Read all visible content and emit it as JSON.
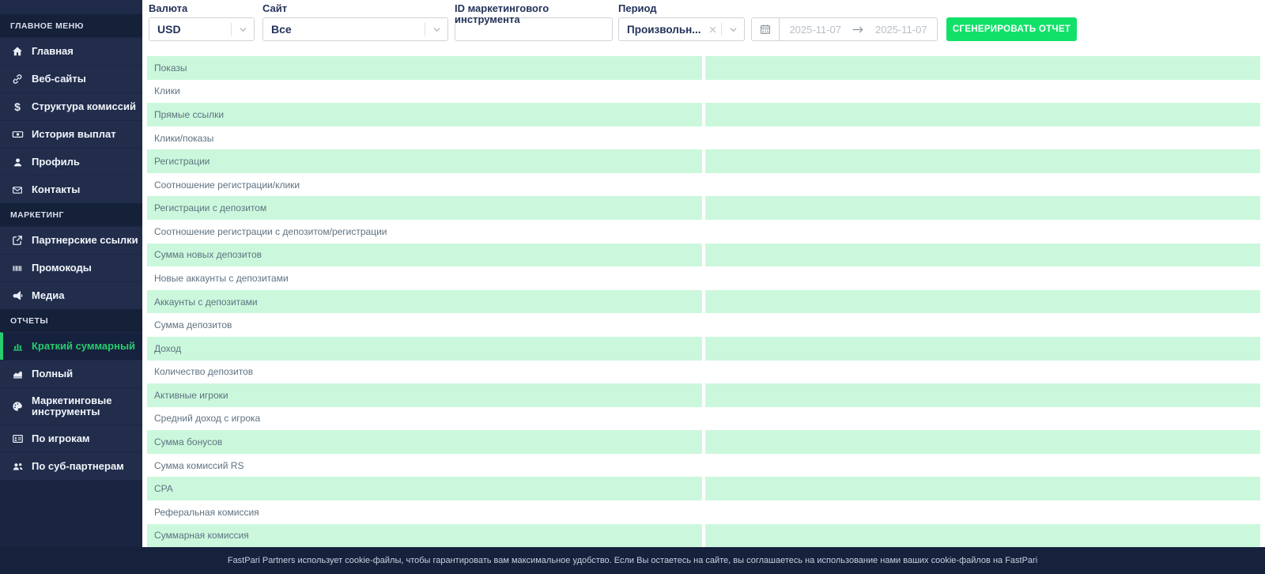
{
  "sidebar": {
    "sections": [
      {
        "header": "ГЛАВНОЕ МЕНЮ",
        "items": [
          {
            "label": "Главная",
            "icon": "home-icon"
          },
          {
            "label": "Веб-сайты",
            "icon": "link-icon"
          },
          {
            "label": "Структура комиссий",
            "icon": "dollar-icon"
          },
          {
            "label": "История выплат",
            "icon": "banknote-icon"
          },
          {
            "label": "Профиль",
            "icon": "user-icon"
          },
          {
            "label": "Контакты",
            "icon": "envelope-icon"
          }
        ]
      },
      {
        "header": "МАРКЕТИНГ",
        "items": [
          {
            "label": "Партнерские ссылки",
            "icon": "external-link-icon"
          },
          {
            "label": "Промокоды",
            "icon": "barcode-icon"
          },
          {
            "label": "Медиа",
            "icon": "megaphone-icon"
          }
        ]
      },
      {
        "header": "ОТЧЕТЫ",
        "items": [
          {
            "label": "Краткий суммарный",
            "icon": "bar-chart-icon",
            "active": true
          },
          {
            "label": "Полный",
            "icon": "area-chart-icon"
          },
          {
            "label": "Маркетинговые инструменты",
            "icon": "palette-icon",
            "tall": true
          },
          {
            "label": "По игрокам",
            "icon": "id-card-icon"
          },
          {
            "label": "По суб-партнерам",
            "icon": "users-icon"
          }
        ]
      }
    ]
  },
  "filters": {
    "currency": {
      "label": "Валюта",
      "value": "USD"
    },
    "site": {
      "label": "Сайт",
      "value": "Все"
    },
    "marketing_id": {
      "label": "ID маркетингового инструмента",
      "value": ""
    },
    "period": {
      "label": "Период",
      "value": "Произвольн..."
    },
    "date_from": "2025-11-07",
    "date_to": "2025-11-07",
    "generate_button": "СГЕНЕРИРОВАТЬ ОТЧЕТ"
  },
  "report": {
    "rows": [
      {
        "label": "Показы",
        "value": ""
      },
      {
        "label": "Клики",
        "value": ""
      },
      {
        "label": "Прямые ссылки",
        "value": ""
      },
      {
        "label": "Клики/показы",
        "value": ""
      },
      {
        "label": "Регистрации",
        "value": ""
      },
      {
        "label": "Соотношение регистрации/клики",
        "value": ""
      },
      {
        "label": "Регистрации с депозитом",
        "value": ""
      },
      {
        "label": "Соотношение регистрации с депозитом/регистрации",
        "value": ""
      },
      {
        "label": "Сумма новых депозитов",
        "value": ""
      },
      {
        "label": "Новые аккаунты с депозитами",
        "value": ""
      },
      {
        "label": "Аккаунты с депозитами",
        "value": ""
      },
      {
        "label": "Сумма депозитов",
        "value": ""
      },
      {
        "label": "Доход",
        "value": ""
      },
      {
        "label": "Количество депозитов",
        "value": ""
      },
      {
        "label": "Активные игроки",
        "value": ""
      },
      {
        "label": "Средний доход с игрока",
        "value": ""
      },
      {
        "label": "Сумма бонусов",
        "value": ""
      },
      {
        "label": "Сумма комиссий RS",
        "value": ""
      },
      {
        "label": "CPA",
        "value": ""
      },
      {
        "label": "Реферальная комиссия",
        "value": ""
      },
      {
        "label": "Суммарная комиссия",
        "value": ""
      }
    ]
  },
  "footer": {
    "text": "FastPari Partners использует cookie-файлы, чтобы гарантировать вам максимальное удобство. Если Вы остаетесь на сайте, вы соглашаетесь на использование нами ваших cookie-файлов на FastPari"
  },
  "colors": {
    "accent_green": "#12e169",
    "active_menu_green": "#27cd6e",
    "row_green": "#cbf8dc",
    "sidebar_bg": "#212d4b",
    "sidebar_band": "#152039",
    "footer_bg": "#16213c"
  }
}
